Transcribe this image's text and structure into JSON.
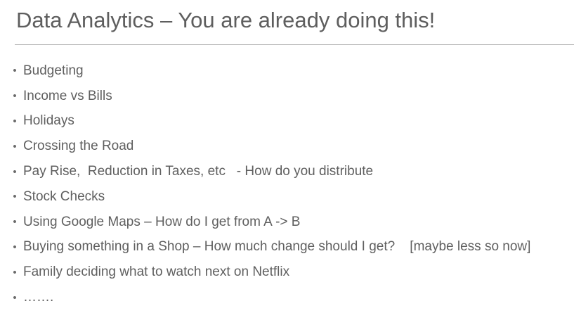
{
  "slide": {
    "title": "Data Analytics – You are already doing this!",
    "bullet_symbol": "•",
    "items": [
      "Budgeting",
      "Income vs Bills",
      "Holidays",
      "Crossing the Road",
      "Pay Rise,  Reduction in Taxes, etc   - How do you distribute",
      "Stock Checks",
      "Using Google Maps – How do I get from A -> B",
      "Buying something in a Shop – How much change should I get?    [maybe less so now]",
      "Family deciding what to watch next on Netflix",
      "……."
    ]
  }
}
